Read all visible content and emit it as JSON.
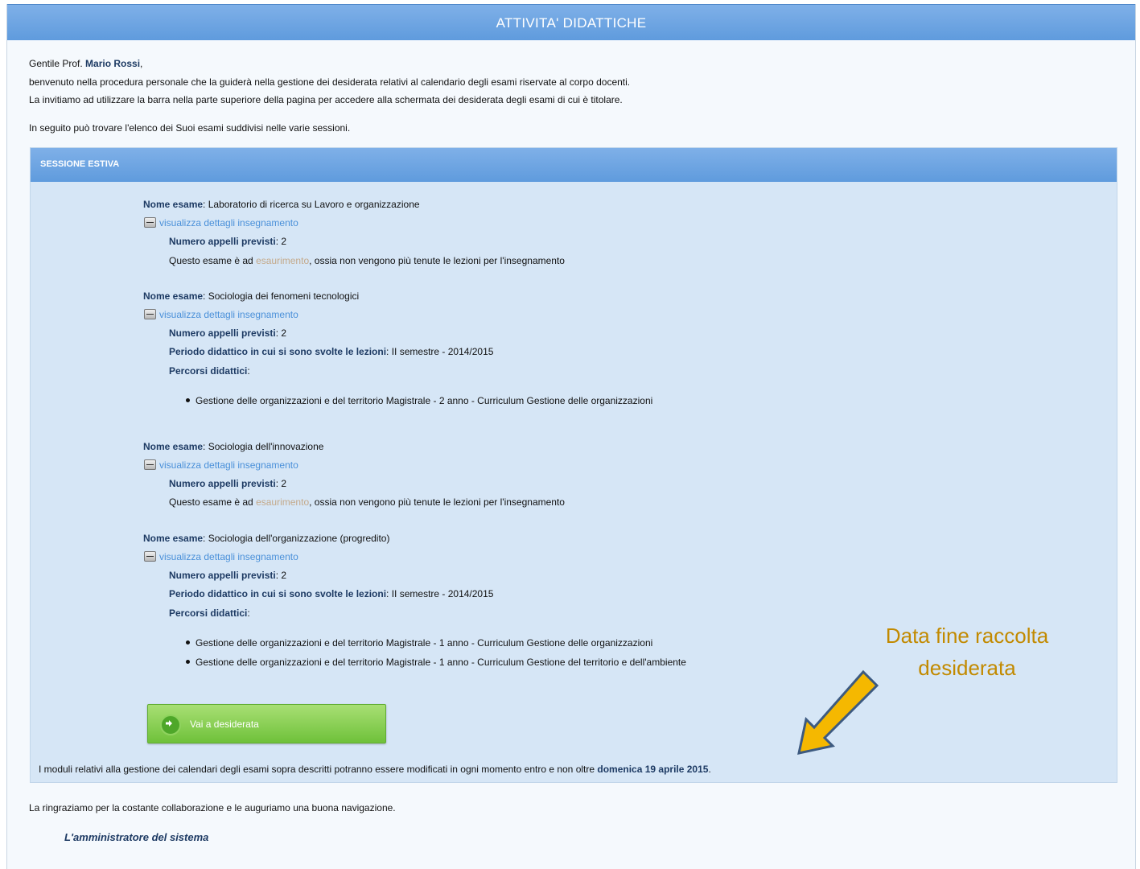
{
  "page": {
    "title": "ATTIVITA' DIDATTICHE"
  },
  "intro": {
    "greeting_prefix": "Gentile Prof. ",
    "professor_name": "Mario Rossi",
    "greeting_suffix": ",",
    "line2": "benvenuto nella procedura personale che la guiderà nella gestione dei desiderata relativi al calendario degli esami riservate al corpo docenti.",
    "line3": "La invitiamo ad utilizzare la barra nella parte superiore della pagina per accedere alla schermata dei desiderata degli esami di cui è titolare.",
    "line4": "In seguito può trovare l'elenco dei Suoi esami suddivisi nelle varie sessioni."
  },
  "session": {
    "title": "SESSIONE ESTIVA",
    "labels": {
      "nome": "Nome esame",
      "details_link": "visualizza dettagli insegnamento",
      "appelli": "Numero appelli previsti",
      "periodo": "Periodo didattico in cui si sono svolte le lezioni",
      "percorsi": "Percorsi didattici",
      "esaurimento_pre": "Questo esame è ad ",
      "esaurimento_word": "esaurimento",
      "esaurimento_post": ", ossia non vengono più tenute le lezioni per l'insegnamento"
    },
    "exams": [
      {
        "name": "Laboratorio di ricerca su Lavoro e organizzazione",
        "appelli": "2"
      },
      {
        "name": "Sociologia dei fenomeni tecnologici",
        "appelli": "2",
        "periodo": "II semestre - 2014/2015",
        "percorsi": [
          "Gestione delle organizzazioni e del territorio Magistrale - 2 anno - Curriculum Gestione delle organizzazioni"
        ]
      },
      {
        "name": "Sociologia dell'innovazione",
        "appelli": "2"
      },
      {
        "name": "Sociologia dell'organizzazione (progredito)",
        "appelli": "2",
        "periodo": "II semestre - 2014/2015",
        "percorsi": [
          "Gestione delle organizzazioni e del territorio Magistrale - 1 anno - Curriculum Gestione delle organizzazioni",
          "Gestione delle organizzazioni e del territorio Magistrale - 1 anno - Curriculum Gestione del territorio e dell'ambiente"
        ]
      }
    ],
    "button_label": "Vai a desiderata",
    "deadline_text": "I moduli relativi alla gestione dei calendari degli esami sopra descritti potranno essere modificati in ogni momento entro e non oltre ",
    "deadline_date": "domenica 19 aprile 2015",
    "deadline_end": "."
  },
  "footer": {
    "thanks": "La ringraziamo per la costante collaborazione e le auguriamo una buona navigazione.",
    "signature": "L'amministratore del sistema"
  },
  "annotation": {
    "line1": "Data fine raccolta",
    "line2": "desiderata",
    "color": "#c28a00",
    "arrow_color": "#f5b800",
    "icon": "arrow-down-left-icon"
  }
}
